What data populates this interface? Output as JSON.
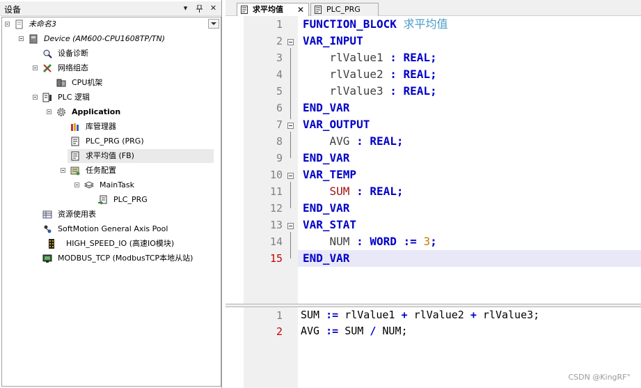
{
  "devices_panel": {
    "title": "设备",
    "pin_glyph": "▾",
    "pin2_glyph": "ᵠ",
    "close_glyph": "✕",
    "tree": [
      {
        "label": "未命名3"
      },
      {
        "label": "Device (AM600-CPU1608TP/TN)"
      },
      {
        "label": "设备诊断"
      },
      {
        "label": "网络组态"
      },
      {
        "label": "CPU机架"
      },
      {
        "label": "PLC 逻辑"
      },
      {
        "label": "Application"
      },
      {
        "label": "库管理器"
      },
      {
        "label": "PLC_PRG (PRG)"
      },
      {
        "label": "求平均值 (FB)"
      },
      {
        "label": "任务配置"
      },
      {
        "label": "MainTask"
      },
      {
        "label": "PLC_PRG"
      },
      {
        "label": "资源使用表"
      },
      {
        "label": "SoftMotion General Axis Pool"
      },
      {
        "label": "HIGH_SPEED_IO (高速IO模块)"
      },
      {
        "label": "MODBUS_TCP (ModbusTCP本地从站)"
      }
    ]
  },
  "tabs": [
    {
      "label": "求平均值",
      "close": "✕",
      "active": true
    },
    {
      "label": "PLC_PRG",
      "active": false
    }
  ],
  "declaration": {
    "line_numbers": [
      "1",
      "2",
      "3",
      "4",
      "5",
      "6",
      "7",
      "8",
      "9",
      "10",
      "11",
      "12",
      "13",
      "14",
      "15"
    ],
    "fb_keyword": "FUNCTION_BLOCK",
    "fb_name": "求平均值",
    "var_input": "VAR_INPUT",
    "in1": "rlValue1",
    "in2": "rlValue2",
    "in3": "rlValue3",
    "colon": ":",
    "real": "REAL;",
    "end_var": "END_VAR",
    "var_output": "VAR_OUTPUT",
    "avg": "AVG",
    "var_temp": "VAR_TEMP",
    "sum": "SUM",
    "var_stat": "VAR_STAT",
    "num": "NUM",
    "word": "WORD",
    "assign": ":=",
    "three": "3",
    "semicolon": ";"
  },
  "implementation": {
    "line_numbers": [
      "1",
      "2"
    ],
    "line1": {
      "lhs": "SUM",
      "op": ":=",
      "a": "rlValue1",
      "plus": "+",
      "b": "rlValue2",
      "c": "rlValue3;"
    },
    "line2": {
      "lhs": "AVG",
      "op": ":=",
      "a": "SUM",
      "div": "/",
      "b": "NUM;"
    }
  },
  "watermark": "CSDN @KingRF°"
}
